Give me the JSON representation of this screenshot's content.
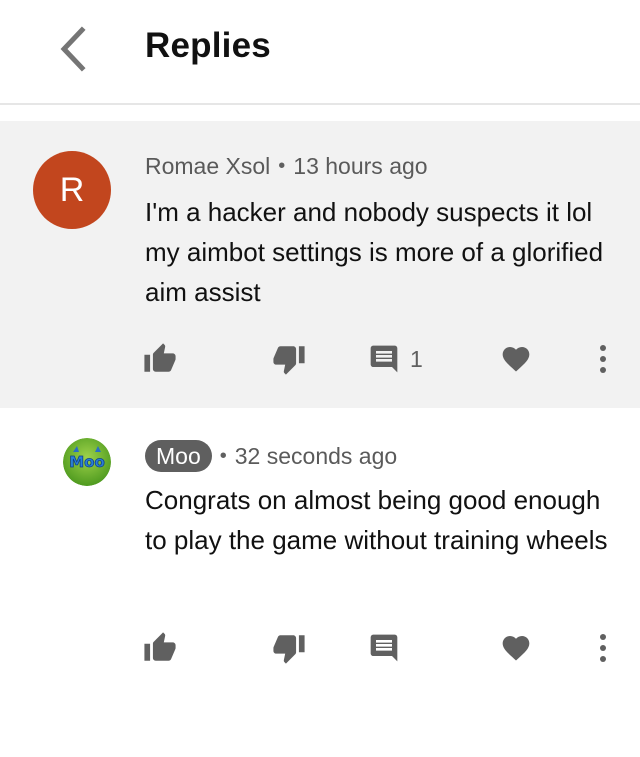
{
  "header": {
    "title": "Replies",
    "back_icon": "chevron-left-icon"
  },
  "comments": [
    {
      "author": "Romae Xsol",
      "avatar_letter": "R",
      "avatar_color": "#c2461e",
      "time": "13 hours ago",
      "text": "I'm a hacker and nobody suspects it lol my aimbot settings is more of a glorified aim assist",
      "reply_count": "1",
      "highlighted": true
    },
    {
      "author": "Moo",
      "avatar_text": "Moo",
      "avatar_type": "logo",
      "time": "32 seconds ago",
      "text": "Congrats on almost being good enough to play the game without training wheels",
      "reply_count": "",
      "author_chip": true
    }
  ],
  "action_icons": [
    "thumbs-up-icon",
    "thumbs-down-icon",
    "reply-icon",
    "heart-icon",
    "more-vert-icon"
  ],
  "colors": {
    "icon": "#606060",
    "highlight_bg": "#f2f2f2",
    "chip_bg": "#5f5f5f"
  }
}
